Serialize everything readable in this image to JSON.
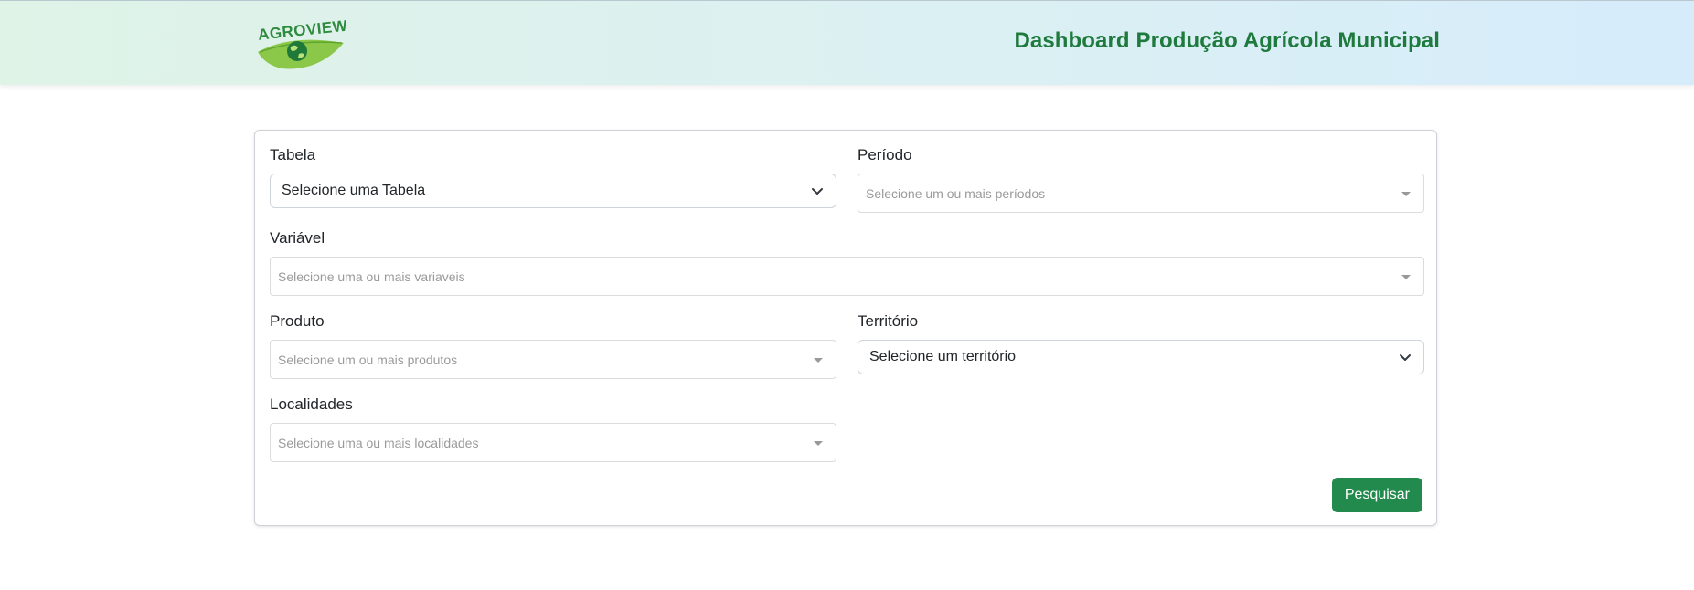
{
  "header": {
    "logo_text": "AGROVIEW",
    "title": "Dashboard Produção Agrícola Municipal"
  },
  "form": {
    "tabela": {
      "label": "Tabela",
      "value": "Selecione uma Tabela"
    },
    "periodo": {
      "label": "Período",
      "placeholder": "Selecione um ou mais períodos"
    },
    "variavel": {
      "label": "Variável",
      "placeholder": "Selecione uma ou mais variaveis"
    },
    "produto": {
      "label": "Produto",
      "placeholder": "Selecione um ou mais produtos"
    },
    "territorio": {
      "label": "Território",
      "value": "Selecione um território"
    },
    "localidades": {
      "label": "Localidades",
      "placeholder": "Selecione uma ou mais localidades"
    },
    "submit_label": "Pesquisar"
  },
  "colors": {
    "brand_green": "#1e7a3d",
    "button_green": "#218a4c"
  }
}
